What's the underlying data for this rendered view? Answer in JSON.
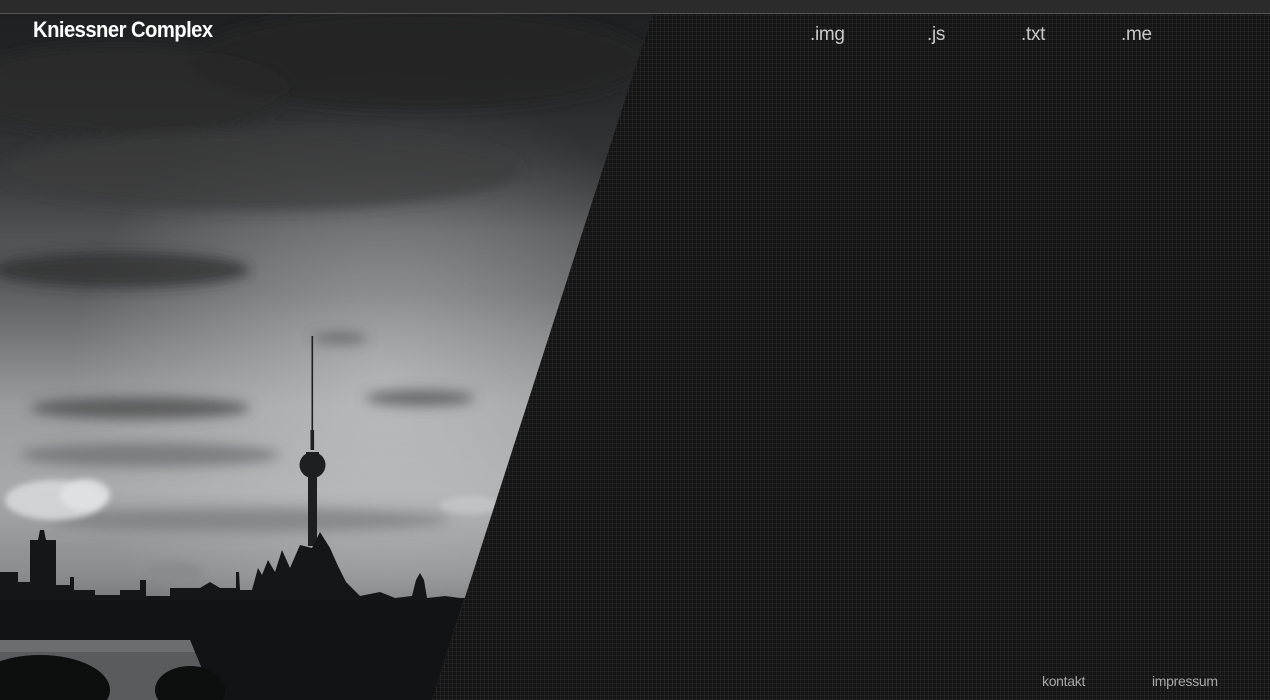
{
  "site": {
    "title": "Kniessner Complex"
  },
  "nav": {
    "items": [
      {
        "label": ".img"
      },
      {
        "label": ".js"
      },
      {
        "label": ".txt"
      },
      {
        "label": ".me"
      }
    ]
  },
  "footer": {
    "links": [
      {
        "label": "kontakt"
      },
      {
        "label": "impressum"
      }
    ]
  },
  "colors": {
    "background": "#151515",
    "grid_line": "#262626",
    "title_text": "#ffffff",
    "nav_text": "#c8c8c8",
    "footer_text": "#a8a8a8"
  }
}
